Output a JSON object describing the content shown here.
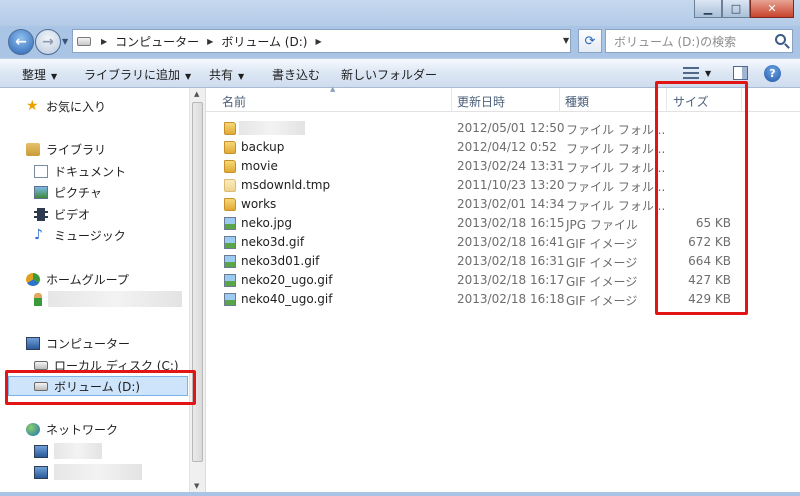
{
  "address": {
    "crumbs": [
      "コンピューター",
      "ボリューム (D:)"
    ],
    "search_placeholder": "ボリューム (D:)の検索"
  },
  "toolbar": {
    "organize": "整理",
    "add_to_library": "ライブラリに追加",
    "share": "共有",
    "burn": "書き込む",
    "new_folder": "新しいフォルダー"
  },
  "nav": {
    "favorites": "お気に入り",
    "libraries": "ライブラリ",
    "documents": "ドキュメント",
    "pictures": "ピクチャ",
    "videos": "ビデオ",
    "music": "ミュージック",
    "homegroup": "ホームグループ",
    "computer": "コンピューター",
    "local_disk": "ローカル ディスク (C:)",
    "volume_d": "ボリューム (D:)",
    "network": "ネットワーク"
  },
  "columns": {
    "name": "名前",
    "date": "更新日時",
    "type": "種類",
    "size": "サイズ"
  },
  "files": [
    {
      "name": "",
      "date": "2012/05/01 12:50",
      "type": "ファイル フォル...",
      "size": "",
      "icon": "folder-icon"
    },
    {
      "name": "backup",
      "date": "2012/04/12 0:52",
      "type": "ファイル フォル...",
      "size": "",
      "icon": "folder-icon"
    },
    {
      "name": "movie",
      "date": "2013/02/24 13:31",
      "type": "ファイル フォル...",
      "size": "",
      "icon": "folder-icon"
    },
    {
      "name": "msdownld.tmp",
      "date": "2011/10/23 13:20",
      "type": "ファイル フォル...",
      "size": "",
      "icon": "hidden-folder-icon"
    },
    {
      "name": "works",
      "date": "2013/02/01 14:34",
      "type": "ファイル フォル...",
      "size": "",
      "icon": "folder-icon"
    },
    {
      "name": "neko.jpg",
      "date": "2013/02/18 16:15",
      "type": "JPG ファイル",
      "size": "65 KB",
      "icon": "image-icon"
    },
    {
      "name": "neko3d.gif",
      "date": "2013/02/18 16:41",
      "type": "GIF イメージ",
      "size": "672 KB",
      "icon": "image-icon"
    },
    {
      "name": "neko3d01.gif",
      "date": "2013/02/18 16:31",
      "type": "GIF イメージ",
      "size": "664 KB",
      "icon": "image-icon"
    },
    {
      "name": "neko20_ugo.gif",
      "date": "2013/02/18 16:17",
      "type": "GIF イメージ",
      "size": "427 KB",
      "icon": "image-icon"
    },
    {
      "name": "neko40_ugo.gif",
      "date": "2013/02/18 16:18",
      "type": "GIF イメージ",
      "size": "429 KB",
      "icon": "image-icon"
    }
  ],
  "highlight_color": "#e21414"
}
